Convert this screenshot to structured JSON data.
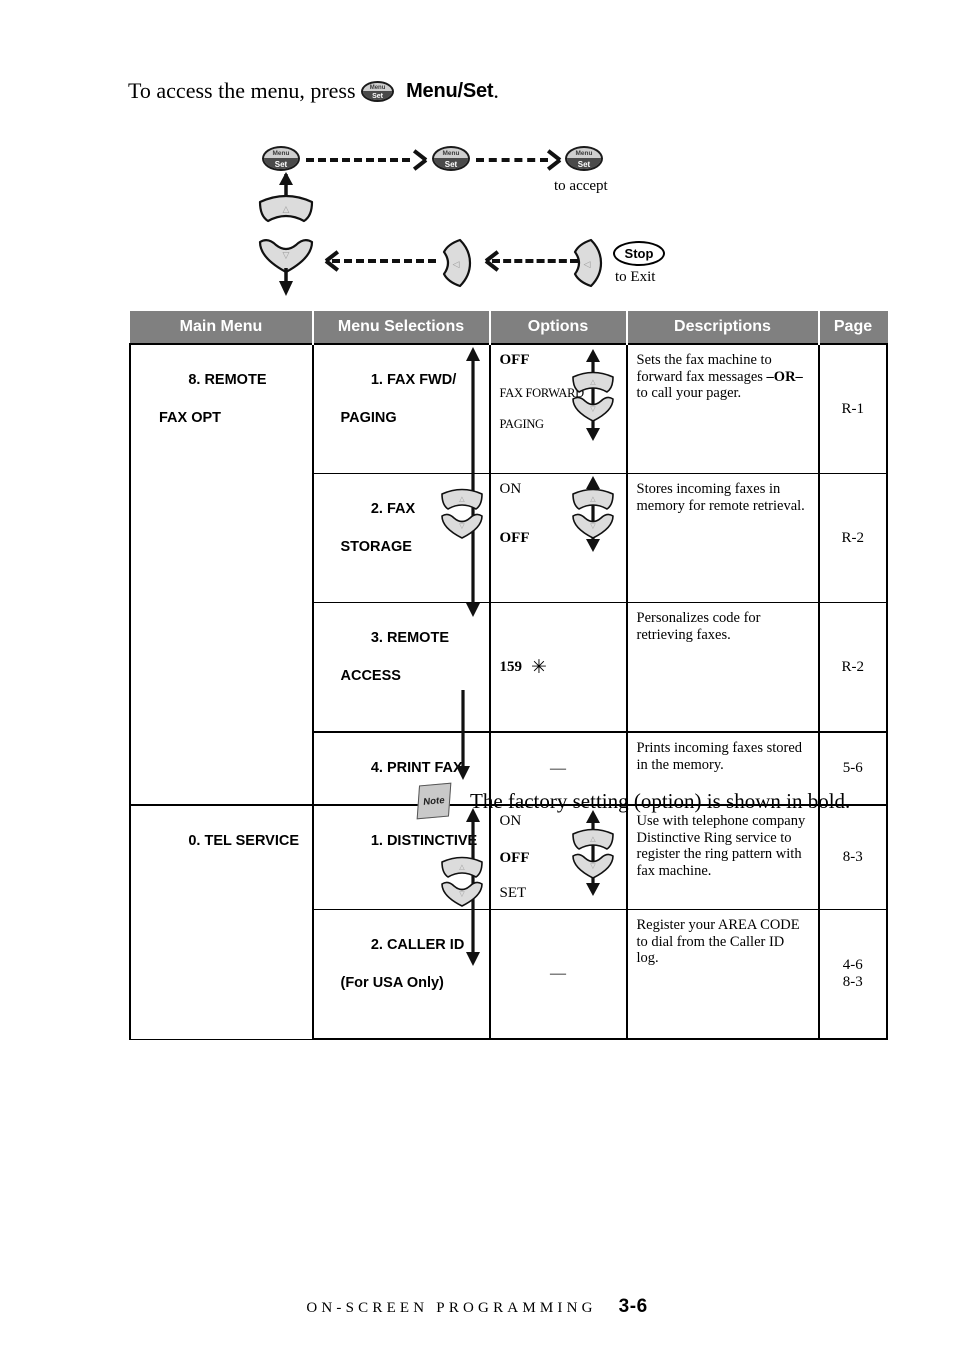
{
  "intro": {
    "before": "To access the menu, press ",
    "button_top": "Menu",
    "button_bottom": "Set",
    "after": " Menu/Set",
    "period": "."
  },
  "flow": {
    "btn1": {
      "top": "Menu",
      "bottom": "Set"
    },
    "btn2": {
      "top": "Menu",
      "bottom": "Set"
    },
    "btn3": {
      "top": "Menu",
      "bottom": "Set"
    },
    "to_accept": "to accept",
    "to_exit": "to Exit",
    "stop_label": "Stop",
    "up_key_glyph": "△",
    "down_key_glyph": "▽",
    "left_key_glyph": "◁"
  },
  "table": {
    "headers": [
      "Main Menu",
      "Menu Selections",
      "Options",
      "Descriptions",
      "Page"
    ],
    "groups": [
      {
        "main_menu": "8. REMOTE",
        "main_menu_line2": "FAX OPT",
        "rows": [
          {
            "selection": "1. FAX FWD/",
            "selection_line2": "PAGING",
            "options": [
              "OFF",
              "FAX FORWARD",
              "PAGING"
            ],
            "options_bold": [
              true,
              false,
              false
            ],
            "options_small": [
              false,
              true,
              true
            ],
            "description_plain_1": "Sets the fax machine to forward fax messages ",
            "description_bold": "–OR–",
            "description_plain_2": "to call your pager.",
            "page": "R-1"
          },
          {
            "selection": "2. FAX",
            "selection_line2": "STORAGE",
            "options": [
              "ON",
              "OFF"
            ],
            "options_bold": [
              false,
              true
            ],
            "options_small": [
              false,
              false
            ],
            "description_plain_1": "Stores incoming faxes in memory for remote retrieval.",
            "description_bold": "",
            "description_plain_2": "",
            "page": "R-2"
          },
          {
            "selection": "3. REMOTE",
            "selection_line2": "ACCESS",
            "options": [
              "159"
            ],
            "options_bold": [
              true
            ],
            "options_small": [
              false
            ],
            "option_symbol": "✳",
            "description_plain_1": "Personalizes code for retrieving faxes.",
            "description_bold": "",
            "description_plain_2": "",
            "page": "R-2"
          },
          {
            "selection": "4. PRINT FAX",
            "selection_line2": "",
            "options": [],
            "options_bold": [],
            "options_small": [],
            "option_dash": "—",
            "description_plain_1": "Prints incoming faxes stored in the memory.",
            "description_bold": "",
            "description_plain_2": "",
            "page": "5-6"
          }
        ]
      },
      {
        "main_menu": "0. TEL SERVICE",
        "main_menu_line2": "",
        "rows": [
          {
            "selection": "1. DISTINCTIVE",
            "selection_line2": "",
            "options": [
              "ON",
              "OFF",
              "SET"
            ],
            "options_bold": [
              false,
              true,
              false
            ],
            "options_small": [
              false,
              false,
              false
            ],
            "description_plain_1": "Use with telephone company Distinctive Ring service to register the ring pattern with fax machine.",
            "description_bold": "",
            "description_plain_2": "",
            "page": "8-3"
          },
          {
            "selection": "2. CALLER ID",
            "selection_line2": "(For USA Only)",
            "options": [],
            "options_bold": [],
            "options_small": [],
            "option_dash": "—",
            "description_plain_1": "Register your AREA CODE to dial from the Caller ID log.",
            "description_bold": "",
            "description_plain_2": "",
            "page": "4-6",
            "page_line2": "8-3"
          }
        ]
      }
    ]
  },
  "note": {
    "icon_label": "Note",
    "text": "The factory setting (option) is shown in bold."
  },
  "footer": {
    "chapter_title": "ON-SCREEN PROGRAMMING",
    "page_number": "3-6"
  },
  "colors": {
    "header_bg": "#808080",
    "header_text": "#ffffff",
    "button_gray": "#cfcfcf",
    "button_dark": "#4a4a4a",
    "note_gray": "#c9c9c9"
  }
}
